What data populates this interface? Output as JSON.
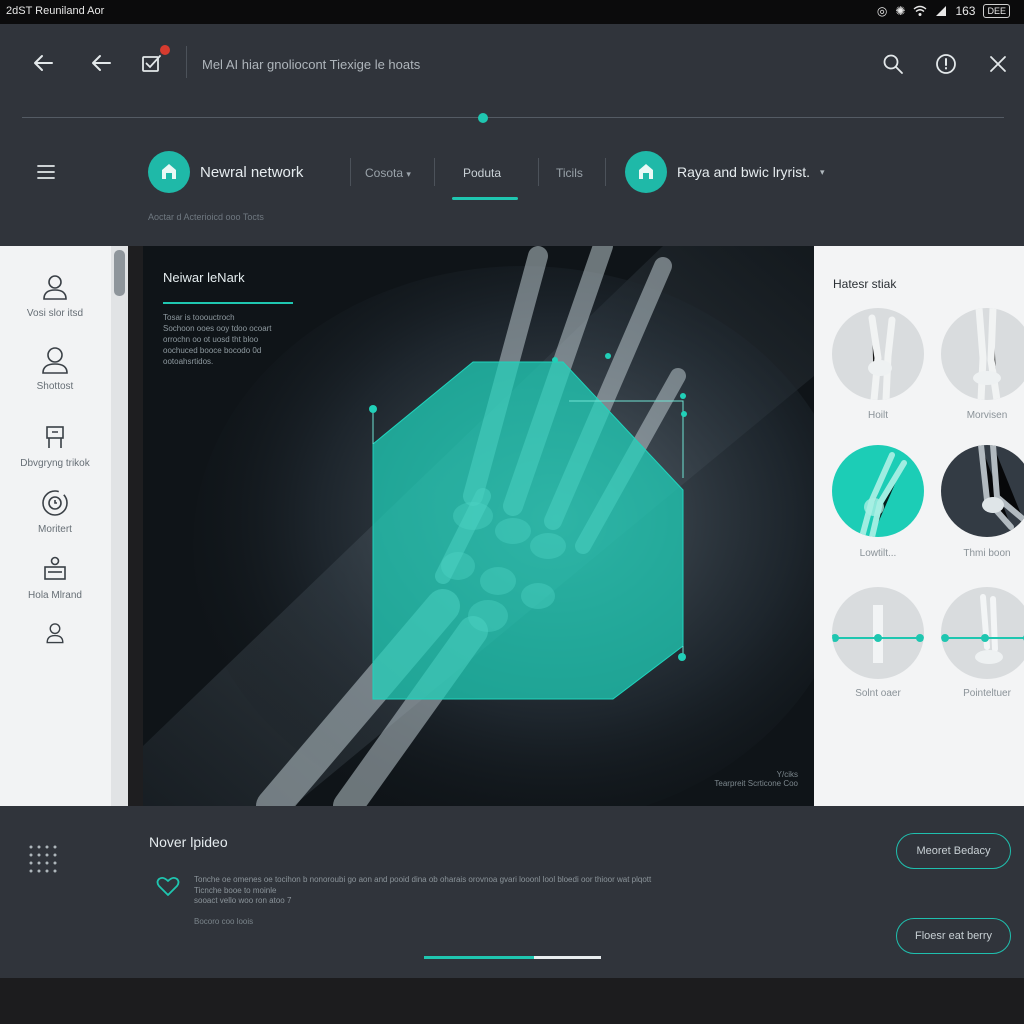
{
  "status_bar": {
    "left_text": "2dST Reuniland Aor",
    "time": "163",
    "battery": "DEE"
  },
  "toolbar": {
    "title": "Mel AI hiar gnoliocont  Tiexige le hoats"
  },
  "nav": {
    "chip1_label": "Newral network",
    "tab_category": "Cosota",
    "tab_products": "Poduta",
    "tab_tools": "Ticils",
    "chip2_label": "Raya and bwic lryrist.",
    "subcaption": "Aoctar d Acterioicd ooo Tocts"
  },
  "sidebar": {
    "items": [
      {
        "label": "Vosi slor itsd",
        "icon": "user-icon"
      },
      {
        "label": "Shottost",
        "icon": "person-icon"
      },
      {
        "label": "Dbvgryng trikok",
        "icon": "device-icon"
      },
      {
        "label": "Moritert",
        "icon": "clock-icon"
      },
      {
        "label": "Hola Mlrand",
        "icon": "profile-card-icon"
      },
      {
        "label": "",
        "icon": "user-small-icon"
      }
    ]
  },
  "viewer": {
    "heading": "Neiwar leNark",
    "lines": [
      "Tosar is tooouctroch",
      "Sochoon ooes ooy tdoo ocoart",
      "orrochn oo ot uosd tht bloo",
      "oochuced booce bocodo 0d",
      "ootoahsrtidos."
    ],
    "corner_top": "Y/ciks",
    "corner_bottom": "Tearpreit Scrticone Coo"
  },
  "right_panel": {
    "title": "Hatesr stiak",
    "thumbs": [
      {
        "label": "Hoilt",
        "style": "gray"
      },
      {
        "label": "Morvisen",
        "style": "gray"
      },
      {
        "label": "Lowtilt...",
        "style": "teal"
      },
      {
        "label": "Thmi boon",
        "style": "dark"
      },
      {
        "label": "Solnt oaer",
        "style": "slider"
      },
      {
        "label": "Pointeltuer",
        "style": "slider"
      }
    ]
  },
  "bottom": {
    "title": "Nover lpideo",
    "desc1": "Tonche oe omenes oe tocihon b nonoroubi go aon and pooid dina ob oharais orovnoa gvari looonl lool bloedi oor thioor wat plqott",
    "desc2": "Ticnche booe to moinle",
    "desc3": "sooact vello woo ron atoo 7",
    "meta": "Bocoro coo loois",
    "button1": "Meoret Bedacy",
    "button2": "Floesr eat berry"
  },
  "colors": {
    "accent": "#1fc6b0",
    "dark": "#30343b",
    "panel": "#f2f3f4"
  }
}
